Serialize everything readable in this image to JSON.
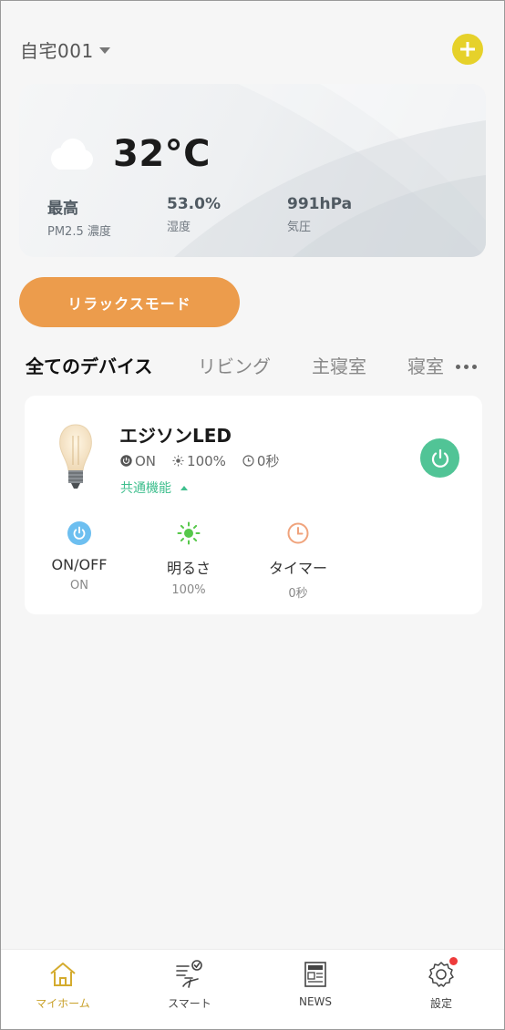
{
  "header": {
    "home_name": "自宅001"
  },
  "weather": {
    "temperature": "32°C",
    "stats": [
      {
        "value": "最高",
        "label": "PM2.5 濃度"
      },
      {
        "value": "53.0%",
        "label": "湿度"
      },
      {
        "value": "991hPa",
        "label": "気圧"
      }
    ]
  },
  "scene": {
    "label": "リラックスモード"
  },
  "tabs": [
    "全てのデバイス",
    "リビング",
    "主寝室",
    "寝室"
  ],
  "device": {
    "name": "エジソンLED",
    "status": {
      "power": "ON",
      "brightness": "100%",
      "timer": "0秒"
    },
    "common_functions": "共通機能",
    "controls": [
      {
        "label": "ON/OFF",
        "value": "ON"
      },
      {
        "label": "明るさ",
        "value": "100%"
      },
      {
        "label": "タイマー",
        "value": "0秒"
      }
    ]
  },
  "nav": [
    {
      "label": "マイホーム"
    },
    {
      "label": "スマート"
    },
    {
      "label": "NEWS"
    },
    {
      "label": "設定"
    }
  ],
  "colors": {
    "accent_yellow": "#e6d12a",
    "scene_orange": "#ec9c4c",
    "power_green": "#51c496",
    "active_nav": "#c9a12a",
    "badge_red": "#ee3b3b"
  }
}
